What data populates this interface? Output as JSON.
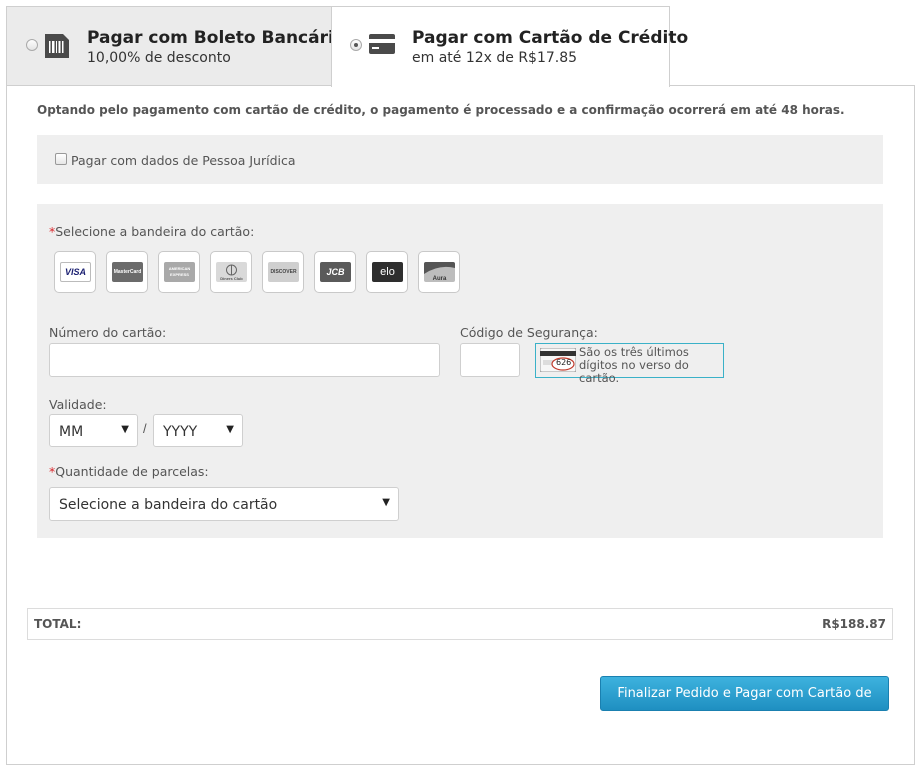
{
  "tabs": {
    "boleto": {
      "title": "Pagar com Boleto Bancário",
      "subtitle": "10,00% de desconto",
      "selected": false
    },
    "cartao": {
      "title": "Pagar com Cartão de Crédito",
      "subtitle": "em até 12x de R$17.85",
      "selected": true
    }
  },
  "notice": "Optando pelo pagamento com cartão de crédito, o pagamento é processado e a confirmação ocorrerá em até 48 horas.",
  "pj": {
    "label": "Pagar com dados de Pessoa Jurídica",
    "checked": false
  },
  "form": {
    "required_mark": "*",
    "brand_label": "Selecione a bandeira do cartão:",
    "brands": [
      {
        "name": "VISA",
        "icon": "visa-icon"
      },
      {
        "name": "MasterCard",
        "icon": "mastercard-icon"
      },
      {
        "name": "AMERICAN EXPRESS",
        "icon": "amex-icon"
      },
      {
        "name": "Diners Club",
        "icon": "diners-icon"
      },
      {
        "name": "DISCOVER",
        "icon": "discover-icon"
      },
      {
        "name": "JCB",
        "icon": "jcb-icon"
      },
      {
        "name": "elo",
        "icon": "elo-icon"
      },
      {
        "name": "Aura",
        "icon": "aura-icon"
      }
    ],
    "card_number_label": "Número do cartão:",
    "security_code_label": "Código de Segurança:",
    "security_help": "São os três últimos dígitos no verso do cartão.",
    "cvv_example": "626",
    "validity_label": "Validade:",
    "month_value": "MM",
    "date_separator": "/",
    "year_value": "YYYY",
    "installments_label": "Quantidade de parcelas:",
    "installments_value": "Selecione a bandeira do cartão"
  },
  "total": {
    "label": "TOTAL:",
    "value": "R$188.87"
  },
  "submit_label": "Finalizar Pedido e Pagar com Cartão de Crédito",
  "colors": {
    "accent": "#2a9fd0",
    "required": "#d9262b",
    "highlight_border": "#3ab1c8"
  }
}
